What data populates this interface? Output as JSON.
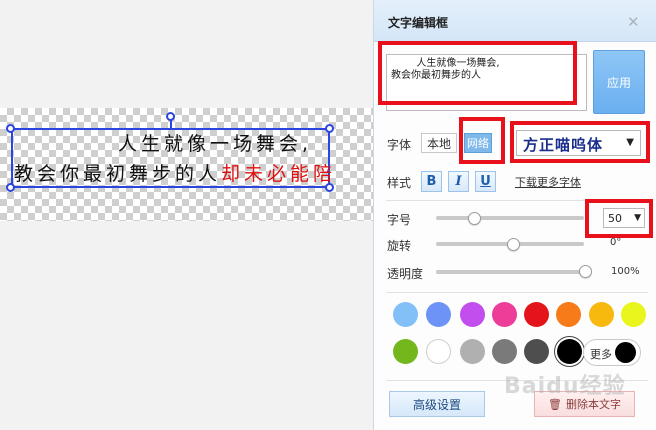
{
  "canvas": {
    "line1": "人生就像一场舞会,",
    "line2": "教会你最初舞步的人",
    "line2_red": "却未必能陪"
  },
  "panel": {
    "title": "文字编辑框",
    "close_glyph": "✕",
    "text_value": "        人生就像一场舞会,\n教会你最初舞步的人",
    "apply_label": "应用",
    "font_label": "字体",
    "font_local": "本地",
    "font_web": "网络",
    "font_name": "方正喵呜体",
    "style_label": "样式",
    "bold_label": "B",
    "italic_label": "I",
    "underline_label": "U",
    "more_fonts_link": "下载更多字体",
    "size_label": "字号",
    "size_value": "50",
    "size_slider_level": 0.17,
    "rotate_label": "旋转",
    "rotate_value": "0°",
    "rotate_slider_level": 0.5,
    "opacity_label": "透明度",
    "opacity_value": "100%",
    "opacity_slider_level": 1.0,
    "colors_row1": [
      "#82c0f7",
      "#6c93f5",
      "#c24fed",
      "#ee3d99",
      "#e3141a",
      "#f77b18",
      "#f8b90e",
      "#eaf41d"
    ],
    "colors_row2": [
      "#73b71c",
      "#ffffff",
      "#b0b0b0",
      "#7a7a7a",
      "#4e4e4e",
      "#000000"
    ],
    "selected_color": "#000000",
    "more_colors_label": "更多",
    "advanced_button": "高级设置",
    "delete_button": "删除本文字",
    "delete_icon": "trash-icon"
  },
  "watermark_text": "Baidu经验",
  "highlight_color": "#e8101a",
  "accent_color": "#2a45e0"
}
